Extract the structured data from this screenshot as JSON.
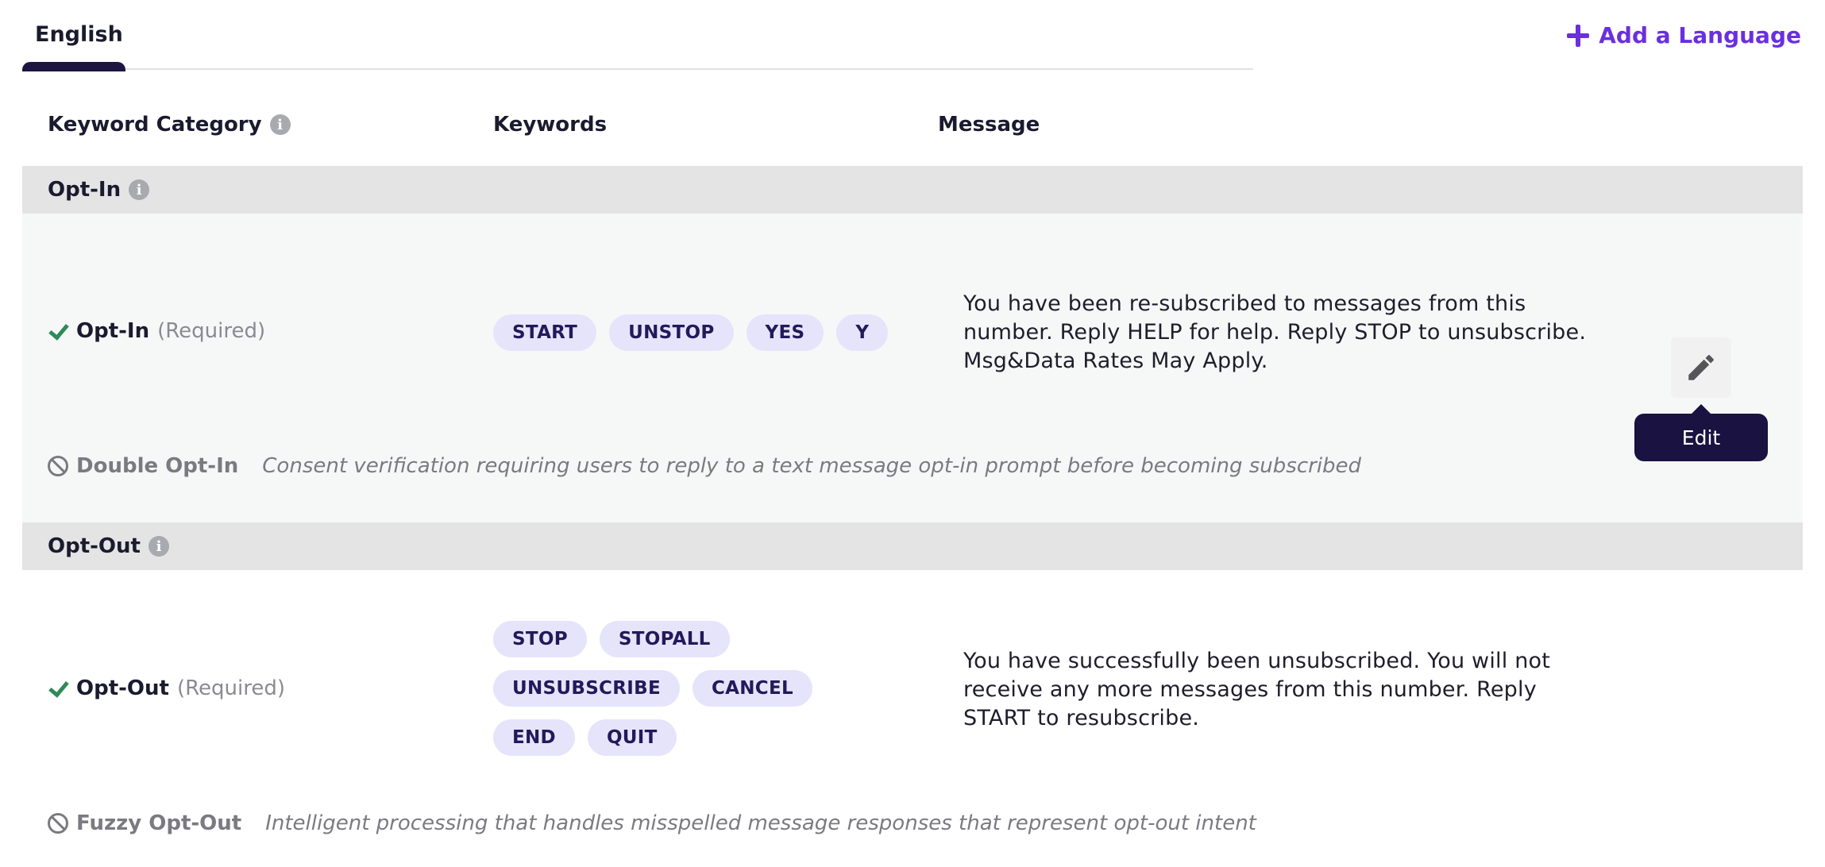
{
  "tabs": [
    {
      "label": "English",
      "active": true
    }
  ],
  "add_language_label": "Add a Language",
  "columns": {
    "category": "Keyword Category",
    "keywords": "Keywords",
    "message": "Message"
  },
  "sections": {
    "opt_in": {
      "title": "Opt-In",
      "row": {
        "name": "Opt-In",
        "required": "(Required)",
        "keywords": [
          "START",
          "UNSTOP",
          "YES",
          "Y"
        ],
        "message": "You have been re-subscribed to messages from this number. Reply HELP for help. Reply STOP to unsubscribe. Msg&Data Rates May Apply."
      },
      "feature": {
        "name": "Double Opt-In",
        "description": "Consent verification requiring users to reply to a text message opt-in prompt before becoming subscribed"
      }
    },
    "opt_out": {
      "title": "Opt-Out",
      "row": {
        "name": "Opt-Out",
        "required": "(Required)",
        "keywords": [
          "STOP",
          "STOPALL",
          "UNSUBSCRIBE",
          "CANCEL",
          "END",
          "QUIT"
        ],
        "message": "You have successfully been unsubscribed. You will not receive any more messages from this number. Reply START to resubscribe."
      },
      "feature": {
        "name": "Fuzzy Opt-Out",
        "description": "Intelligent processing that handles misspelled message responses that represent opt-out intent"
      }
    }
  },
  "edit_tooltip": "Edit",
  "colors": {
    "accent": "#6a2fe0",
    "tab_indicator": "#1d1640",
    "chip_bg": "#e6e4fb",
    "check": "#2e8a56",
    "tooltip_bg": "#1a1240"
  },
  "icons": [
    "plus-icon",
    "info-icon",
    "check-icon",
    "ban-icon",
    "pencil-icon"
  ]
}
